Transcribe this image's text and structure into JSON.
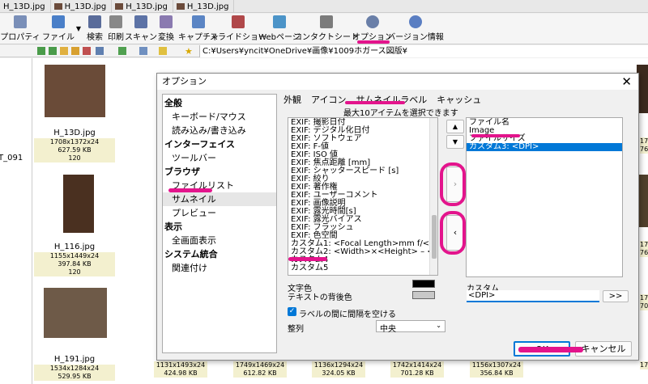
{
  "tabs": [
    {
      "label": "H_13D.jpg"
    },
    {
      "label": "H_13D.jpg"
    },
    {
      "label": "H_13D.jpg"
    },
    {
      "label": "H_13D.jpg"
    }
  ],
  "toolbar": {
    "buttons": [
      {
        "label": "プロパティ",
        "icon": "properties-icon"
      },
      {
        "label": "ファイル",
        "icon": "file-icon"
      },
      {
        "label": "検索",
        "icon": "binoculars-icon"
      },
      {
        "label": "印刷",
        "icon": "print-icon"
      },
      {
        "label": "スキャン",
        "icon": "scan-icon"
      },
      {
        "label": "変換",
        "icon": "convert-icon"
      },
      {
        "label": "キャプチャ",
        "icon": "capture-icon"
      },
      {
        "label": "スライドショー",
        "icon": "slideshow-icon"
      },
      {
        "label": "Webページ",
        "icon": "web-icon"
      },
      {
        "label": "コンタクトシート",
        "icon": "contact-sheet-icon"
      },
      {
        "label": "オプション",
        "icon": "gear-icon"
      },
      {
        "label": "バージョン情報",
        "icon": "info-icon"
      }
    ]
  },
  "address": {
    "path": "C:¥Users¥yncit¥OneDrive¥画像¥1009ホガース図版¥"
  },
  "sidebar": {
    "partial_text": "T_091"
  },
  "thumbnails": {
    "row1": [
      {
        "name": "H_13D.jpg",
        "dims": "1708x1372x24",
        "size": "627.59 KB",
        "num": "120"
      }
    ],
    "row2": [
      {
        "name": "H_116.jpg",
        "dims": "1155x1449x24",
        "size": "397.84 KB",
        "num": "120"
      }
    ],
    "row3": [
      {
        "name": "H_191.jpg",
        "dims": "1534x1284x24",
        "size": "529.95 KB"
      },
      {
        "name": "",
        "dims": "1131x1493x24",
        "size": "424.98 KB"
      },
      {
        "name": "",
        "dims": "1749x1469x24",
        "size": "612.82 KB"
      },
      {
        "name": "",
        "dims": "1136x1294x24",
        "size": "324.05 KB"
      },
      {
        "name": "",
        "dims": "1742x1414x24",
        "size": "701.28 KB"
      },
      {
        "name": "",
        "dims": "1156x1307x24",
        "size": "356.84 KB"
      }
    ],
    "right_partial": {
      "top": [
        "171",
        "76"
      ],
      "mid": [
        "171",
        "76"
      ],
      "low": [
        "174",
        "70"
      ],
      "bot": [
        "176"
      ]
    }
  },
  "dialog": {
    "title": "オプション",
    "tree": [
      {
        "label": "全般",
        "type": "cat"
      },
      {
        "label": "キーボード/マウス",
        "type": "sub"
      },
      {
        "label": "読み込み/書き込み",
        "type": "sub"
      },
      {
        "label": "インターフェイス",
        "type": "cat"
      },
      {
        "label": "ツールバー",
        "type": "sub"
      },
      {
        "label": "ブラウザ",
        "type": "cat"
      },
      {
        "label": "ファイルリスト",
        "type": "sub"
      },
      {
        "label": "サムネイル",
        "type": "sub",
        "selected": true
      },
      {
        "label": "プレビュー",
        "type": "sub"
      },
      {
        "label": "表示",
        "type": "cat"
      },
      {
        "label": "全画面表示",
        "type": "sub"
      },
      {
        "label": "システム統合",
        "type": "cat"
      },
      {
        "label": "関連付け",
        "type": "sub"
      }
    ],
    "tabs": [
      "外観",
      "アイコン",
      "サムネイルラベル",
      "キャッシュ"
    ],
    "hint": "最大10アイテムを選択できます",
    "available": [
      "EXIF: 撮影日付",
      "EXIF: デジタル化日付",
      "EXIF: ソフトウェア",
      "EXIF: F-値",
      "EXIF: ISO 値",
      "EXIF: 焦点距離 [mm]",
      "EXIF: シャッタースピード [s]",
      "EXIF: 絞り",
      "EXIF: 著作権",
      "EXIF: ユーザーコメント",
      "EXIF: 画像説明",
      "EXIF: 露光時間[s]",
      "EXIF: 露光バイアス",
      "EXIF: フラッシュ",
      "EXIF: 色空間",
      "カスタム1: <Focal Length>mm f/<F-...",
      "カスタム2: <Width>×<Height> – <Siz...",
      "カスタム4",
      "カスタム5"
    ],
    "selected_items": [
      {
        "label": "ファイル名"
      },
      {
        "label": "Image"
      },
      {
        "label": "ファイルサイズ"
      },
      {
        "label": "カスタム3: <DPI>",
        "selected": true
      }
    ],
    "move_up": "▲",
    "move_down": "▼",
    "add": "›",
    "remove": "‹",
    "text_color_label": "文字色",
    "text_bg_label": "テキストの背後色",
    "colors": {
      "text": "#000000",
      "bg": "#c8c8c8",
      "mark": "#e3148c",
      "accent": "#0078d7"
    },
    "spacing_label": "ラベルの間に間隔を空ける",
    "align_label": "整列",
    "align_value": "中央",
    "custom_label": "カスタム",
    "custom_value": "<DPI>",
    "custom_btn": ">>",
    "ok": "OK",
    "cancel": "キャンセル"
  }
}
